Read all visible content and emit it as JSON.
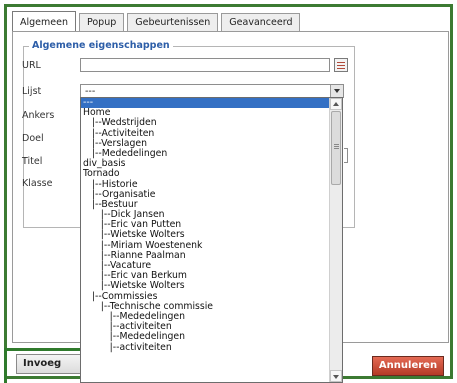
{
  "tabs": [
    {
      "label": "Algemeen",
      "active": true
    },
    {
      "label": "Popup",
      "active": false
    },
    {
      "label": "Gebeurtenissen",
      "active": false
    },
    {
      "label": "Geavanceerd",
      "active": false
    }
  ],
  "section": {
    "legend": "Algemene eigenschappen"
  },
  "fields": {
    "url_label": "URL",
    "url_value": "",
    "lijst_label": "Lijst",
    "lijst_value": "---",
    "ankers_label": "Ankers",
    "doel_label": "Doel",
    "titel_label": "Titel",
    "klasse_label": "Klasse"
  },
  "dropdown": {
    "selected_index": 0,
    "options": [
      "---",
      "Home",
      "   |--Wedstrijden",
      "   |--Activiteiten",
      "   |--Verslagen",
      "   |--Mededelingen",
      "div_basis",
      "Tornado",
      "   |--Historie",
      "   |--Organisatie",
      "   |--Bestuur",
      "      |--Dick Jansen",
      "      |--Eric van Putten",
      "      |--Wietske Wolters",
      "      |--Miriam Woestenenk",
      "      |--Rianne Paalman",
      "      |--Vacature",
      "      |--Eric van Berkum",
      "      |--Wietske Wolters",
      "   |--Commissies",
      "      |--Technische commissie",
      "         |--Mededelingen",
      "         |--activiteiten",
      "         |--Mededelingen",
      "         |--activiteiten"
    ]
  },
  "buttons": {
    "insert_label": "Invoeg",
    "cancel_label": "Annuleren"
  },
  "colors": {
    "highlight_green": "#2f7a2c",
    "selected_blue": "#3470c4",
    "cancel_red": "#c4442e",
    "legend_blue": "#2d5ea8"
  }
}
